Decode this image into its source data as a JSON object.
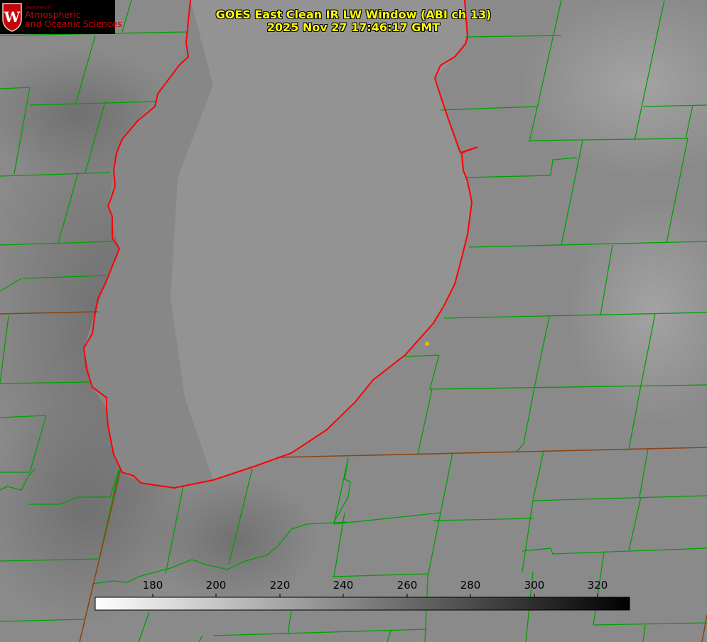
{
  "header": {
    "title_line1": "GOES East Clean IR LW Window (ABI ch 13)",
    "title_line2": "2025 Nov 27 17:46:17 GMT",
    "title_color": "#ffff00"
  },
  "logo": {
    "department": "Department of",
    "name_line1": "Atmospheric",
    "name_line2": "and Oceanic Sciences",
    "emblem_letter": "W",
    "brand_color": "#c5050c"
  },
  "colorbar": {
    "ticks": [
      "180",
      "200",
      "220",
      "240",
      "260",
      "280",
      "300",
      "320"
    ],
    "range": [
      162,
      330
    ],
    "colormap": "white-to-black"
  },
  "map": {
    "county_border_color": "#00a000",
    "coastline_color": "#ff0000",
    "state_border_color": "#8b4513",
    "site_marker_color": "#d4c400"
  }
}
